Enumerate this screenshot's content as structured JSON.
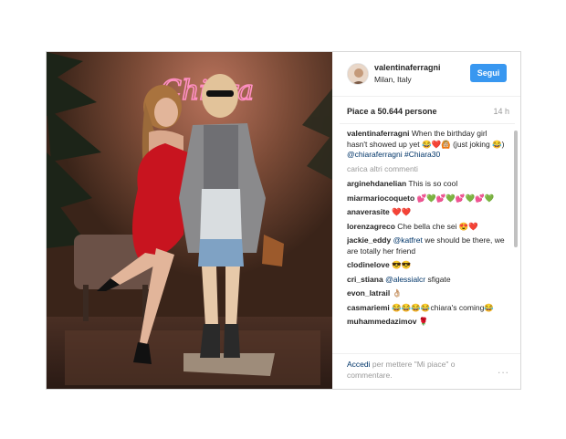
{
  "post": {
    "username": "valentinaferragni",
    "location": "Milan, Italy",
    "follow_label": "Segui",
    "likes": "Piace a 50.644 persone",
    "time": "14 h",
    "neon_text": "Chiara"
  },
  "caption": {
    "user": "valentinaferragni",
    "text": "When the birthday girl hasn't showed up yet 😂❤️🙆🏼",
    "text2": "(just joking 😂)",
    "mention": "@chiaraferragni",
    "hashtag": "#Chiara30"
  },
  "load_more": "carica altri commenti",
  "comments": [
    {
      "user": "arginehdanelian",
      "text": "This is so cool"
    },
    {
      "user": "miarmariocoqueto",
      "text": "💕💚💕💚💕💚💕💚"
    },
    {
      "user": "anaverasite",
      "text": "❤️❤️"
    },
    {
      "user": "lorenzagreco",
      "text": "Che bella che sei 😍❤️"
    },
    {
      "user": "jackie_eddy",
      "mention": "@katfret",
      "text": " we should be there, we are totally her friend"
    },
    {
      "user": "clodinelove",
      "text": "😎😎"
    },
    {
      "user": "cri_stiana",
      "mention": "@alessialcr",
      "text": " sfigate"
    },
    {
      "user": "evon_latrail",
      "text": "👌🏼"
    },
    {
      "user": "casmariemi",
      "text": "😂😂😂😂chiara's coming😂"
    },
    {
      "user": "muhammedazimov",
      "text": "🌹"
    }
  ],
  "footer": {
    "login_link": "Accedi",
    "login_text": " per mettere \"Mi piace\" o commentare.",
    "more_icon": "..."
  },
  "colors": {
    "follow_button": "#3897f0",
    "link": "#003569",
    "neon": "#ff6fae"
  }
}
